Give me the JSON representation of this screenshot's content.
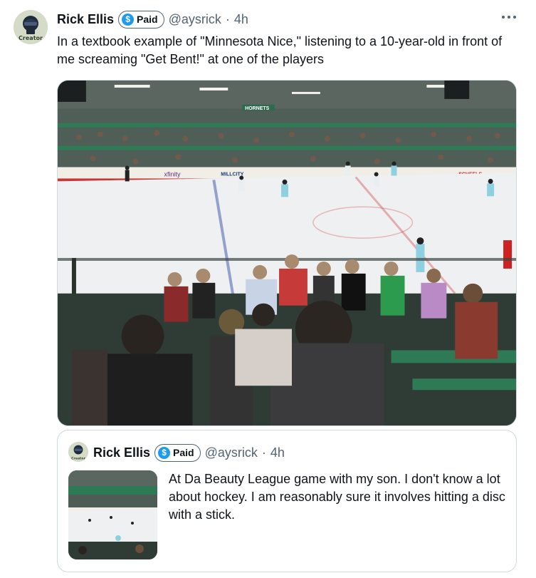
{
  "tweet": {
    "author_name": "Rick Ellis",
    "badge_label": "Paid",
    "badge_symbol": "$",
    "handle": "@aysrick",
    "separator": "·",
    "time": "4h",
    "avatar_text": "Creator",
    "text": "In a textbook example of \"Minnesota Nice,\" listening to a 10-year-old in front of me screaming \"Get Bent!\" at one of the players",
    "more_icon": "more-horizontal-icon"
  },
  "media": {
    "signs": [
      "HORNETS",
      "xfinity",
      "MILLCITY",
      "SCHEELS"
    ]
  },
  "quoted_tweet": {
    "author_name": "Rick Ellis",
    "badge_label": "Paid",
    "badge_symbol": "$",
    "handle": "@aysrick",
    "separator": "·",
    "time": "4h",
    "avatar_text": "Creator",
    "text": "At Da Beauty League game with my son. I don't know a lot about hockey. I am reasonably sure it involves hitting a disc with a stick."
  },
  "colors": {
    "accent": "#1d9bf0",
    "secondary_text": "#536471",
    "border": "#cfd9de",
    "rink_green": "#2d6b4f"
  }
}
